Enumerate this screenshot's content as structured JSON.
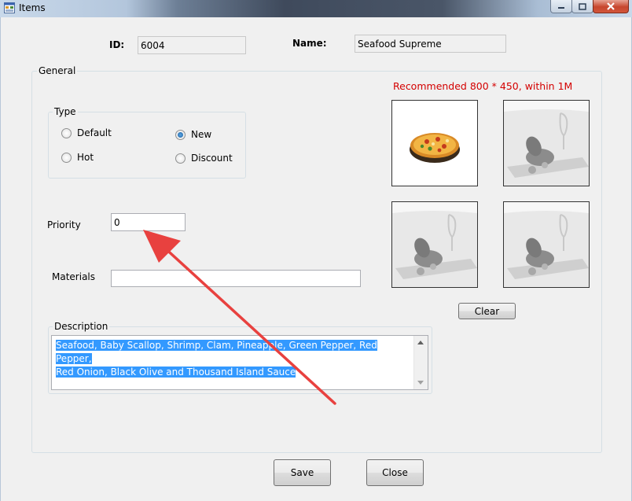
{
  "window": {
    "title": "Items",
    "minimize_icon": "minimize-icon",
    "maximize_icon": "maximize-icon",
    "close_icon": "close-icon"
  },
  "header": {
    "id_label": "ID:",
    "id_value": "6004",
    "name_label": "Name:",
    "name_value": "Seafood Supreme"
  },
  "general": {
    "legend": "General",
    "type": {
      "legend": "Type",
      "options": [
        {
          "label": "Default",
          "checked": false
        },
        {
          "label": "New",
          "checked": true
        },
        {
          "label": "Hot",
          "checked": false
        },
        {
          "label": "Discount",
          "checked": false
        }
      ]
    },
    "priority_label": "Priority",
    "priority_value": "0",
    "materials_label": "Materials",
    "materials_value": "",
    "description_legend": "Description",
    "description_line1": "Seafood, Baby Scallop, Shrimp, Clam, Pineapple, Green Pepper, Red Pepper,",
    "description_line2": "Red Onion, Black Olive and Thousand Island Sauce",
    "image_hint": "Recommended 800 * 450, within 1M",
    "image_hint_color": "#d40000",
    "images": [
      "pizza-image",
      "roast-chicken-image",
      "roast-chicken-image",
      "roast-chicken-image"
    ],
    "clear_label": "Clear"
  },
  "footer": {
    "save_label": "Save",
    "close_label": "Close"
  },
  "annotation": {
    "arrow_color": "#e8413f"
  }
}
